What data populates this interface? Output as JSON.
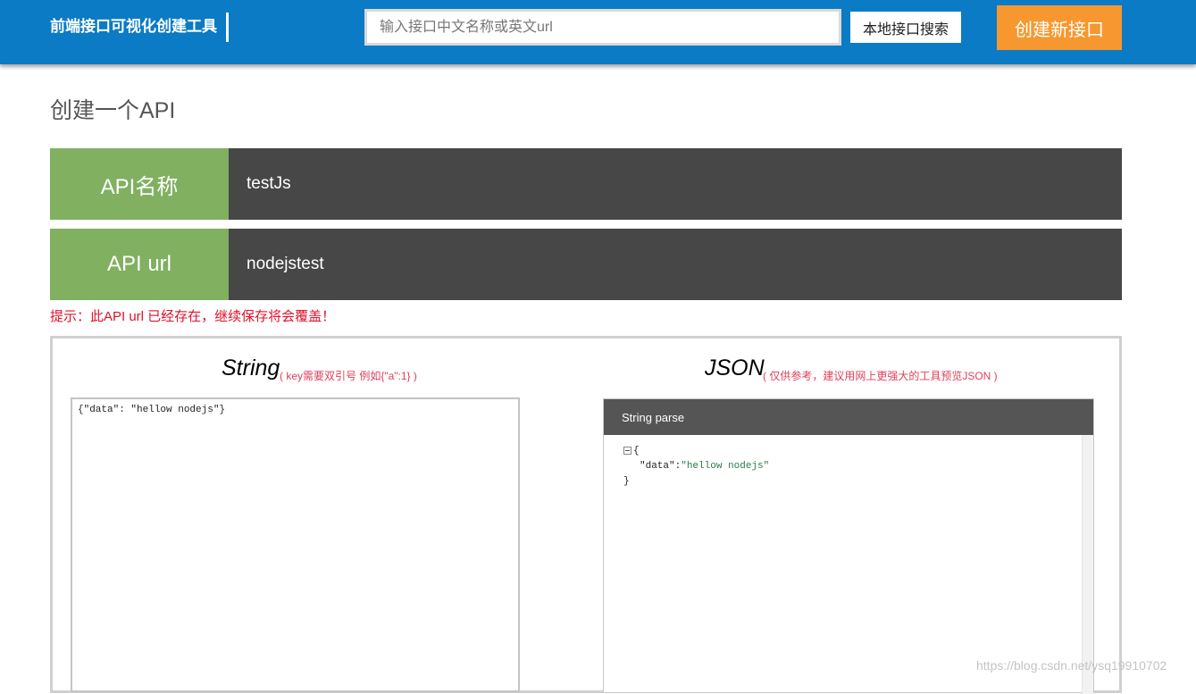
{
  "header": {
    "brand": "前端接口可视化创建工具",
    "search_placeholder": "输入接口中文名称或英文url",
    "search_button": "本地接口搜索",
    "create_button": "创建新接口"
  },
  "main": {
    "title": "创建一个API",
    "fields": [
      {
        "label": "API名称",
        "value": "testJs"
      },
      {
        "label": "API url",
        "value": "nodejstest"
      }
    ],
    "warning": "提示：此API url 已经存在，继续保存将会覆盖！"
  },
  "editor": {
    "string_title": "String",
    "string_hint": "( key需要双引号 例如{\"a\":1} )",
    "string_content": "{\"data\": \"hellow nodejs\"}",
    "json_title": "JSON",
    "json_hint": "( 仅供参考，建议用网上更强大的工具预览JSON )",
    "json_header": "String parse",
    "json_view": {
      "open": "{",
      "key": "\"data\"",
      "colon": ":",
      "value": "\"hellow nodejs\"",
      "close": "}"
    }
  },
  "watermark": "https://blog.csdn.net/ysq19910702",
  "colors": {
    "topbar": "#0a7bc4",
    "create_button": "#f6982f",
    "field_label": "#80b060",
    "field_value": "#474747",
    "warning": "#e0102a"
  }
}
